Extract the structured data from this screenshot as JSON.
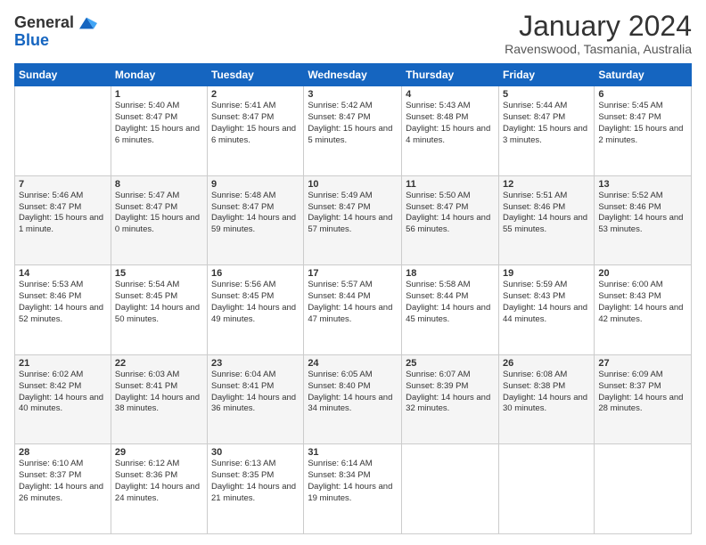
{
  "logo": {
    "general": "General",
    "blue": "Blue"
  },
  "header": {
    "title": "January 2024",
    "location": "Ravenswood, Tasmania, Australia"
  },
  "weekdays": [
    "Sunday",
    "Monday",
    "Tuesday",
    "Wednesday",
    "Thursday",
    "Friday",
    "Saturday"
  ],
  "weeks": [
    [
      {
        "day": "",
        "sunrise": "",
        "sunset": "",
        "daylight": ""
      },
      {
        "day": "1",
        "sunrise": "Sunrise: 5:40 AM",
        "sunset": "Sunset: 8:47 PM",
        "daylight": "Daylight: 15 hours and 6 minutes."
      },
      {
        "day": "2",
        "sunrise": "Sunrise: 5:41 AM",
        "sunset": "Sunset: 8:47 PM",
        "daylight": "Daylight: 15 hours and 6 minutes."
      },
      {
        "day": "3",
        "sunrise": "Sunrise: 5:42 AM",
        "sunset": "Sunset: 8:47 PM",
        "daylight": "Daylight: 15 hours and 5 minutes."
      },
      {
        "day": "4",
        "sunrise": "Sunrise: 5:43 AM",
        "sunset": "Sunset: 8:48 PM",
        "daylight": "Daylight: 15 hours and 4 minutes."
      },
      {
        "day": "5",
        "sunrise": "Sunrise: 5:44 AM",
        "sunset": "Sunset: 8:47 PM",
        "daylight": "Daylight: 15 hours and 3 minutes."
      },
      {
        "day": "6",
        "sunrise": "Sunrise: 5:45 AM",
        "sunset": "Sunset: 8:47 PM",
        "daylight": "Daylight: 15 hours and 2 minutes."
      }
    ],
    [
      {
        "day": "7",
        "sunrise": "Sunrise: 5:46 AM",
        "sunset": "Sunset: 8:47 PM",
        "daylight": "Daylight: 15 hours and 1 minute."
      },
      {
        "day": "8",
        "sunrise": "Sunrise: 5:47 AM",
        "sunset": "Sunset: 8:47 PM",
        "daylight": "Daylight: 15 hours and 0 minutes."
      },
      {
        "day": "9",
        "sunrise": "Sunrise: 5:48 AM",
        "sunset": "Sunset: 8:47 PM",
        "daylight": "Daylight: 14 hours and 59 minutes."
      },
      {
        "day": "10",
        "sunrise": "Sunrise: 5:49 AM",
        "sunset": "Sunset: 8:47 PM",
        "daylight": "Daylight: 14 hours and 57 minutes."
      },
      {
        "day": "11",
        "sunrise": "Sunrise: 5:50 AM",
        "sunset": "Sunset: 8:47 PM",
        "daylight": "Daylight: 14 hours and 56 minutes."
      },
      {
        "day": "12",
        "sunrise": "Sunrise: 5:51 AM",
        "sunset": "Sunset: 8:46 PM",
        "daylight": "Daylight: 14 hours and 55 minutes."
      },
      {
        "day": "13",
        "sunrise": "Sunrise: 5:52 AM",
        "sunset": "Sunset: 8:46 PM",
        "daylight": "Daylight: 14 hours and 53 minutes."
      }
    ],
    [
      {
        "day": "14",
        "sunrise": "Sunrise: 5:53 AM",
        "sunset": "Sunset: 8:46 PM",
        "daylight": "Daylight: 14 hours and 52 minutes."
      },
      {
        "day": "15",
        "sunrise": "Sunrise: 5:54 AM",
        "sunset": "Sunset: 8:45 PM",
        "daylight": "Daylight: 14 hours and 50 minutes."
      },
      {
        "day": "16",
        "sunrise": "Sunrise: 5:56 AM",
        "sunset": "Sunset: 8:45 PM",
        "daylight": "Daylight: 14 hours and 49 minutes."
      },
      {
        "day": "17",
        "sunrise": "Sunrise: 5:57 AM",
        "sunset": "Sunset: 8:44 PM",
        "daylight": "Daylight: 14 hours and 47 minutes."
      },
      {
        "day": "18",
        "sunrise": "Sunrise: 5:58 AM",
        "sunset": "Sunset: 8:44 PM",
        "daylight": "Daylight: 14 hours and 45 minutes."
      },
      {
        "day": "19",
        "sunrise": "Sunrise: 5:59 AM",
        "sunset": "Sunset: 8:43 PM",
        "daylight": "Daylight: 14 hours and 44 minutes."
      },
      {
        "day": "20",
        "sunrise": "Sunrise: 6:00 AM",
        "sunset": "Sunset: 8:43 PM",
        "daylight": "Daylight: 14 hours and 42 minutes."
      }
    ],
    [
      {
        "day": "21",
        "sunrise": "Sunrise: 6:02 AM",
        "sunset": "Sunset: 8:42 PM",
        "daylight": "Daylight: 14 hours and 40 minutes."
      },
      {
        "day": "22",
        "sunrise": "Sunrise: 6:03 AM",
        "sunset": "Sunset: 8:41 PM",
        "daylight": "Daylight: 14 hours and 38 minutes."
      },
      {
        "day": "23",
        "sunrise": "Sunrise: 6:04 AM",
        "sunset": "Sunset: 8:41 PM",
        "daylight": "Daylight: 14 hours and 36 minutes."
      },
      {
        "day": "24",
        "sunrise": "Sunrise: 6:05 AM",
        "sunset": "Sunset: 8:40 PM",
        "daylight": "Daylight: 14 hours and 34 minutes."
      },
      {
        "day": "25",
        "sunrise": "Sunrise: 6:07 AM",
        "sunset": "Sunset: 8:39 PM",
        "daylight": "Daylight: 14 hours and 32 minutes."
      },
      {
        "day": "26",
        "sunrise": "Sunrise: 6:08 AM",
        "sunset": "Sunset: 8:38 PM",
        "daylight": "Daylight: 14 hours and 30 minutes."
      },
      {
        "day": "27",
        "sunrise": "Sunrise: 6:09 AM",
        "sunset": "Sunset: 8:37 PM",
        "daylight": "Daylight: 14 hours and 28 minutes."
      }
    ],
    [
      {
        "day": "28",
        "sunrise": "Sunrise: 6:10 AM",
        "sunset": "Sunset: 8:37 PM",
        "daylight": "Daylight: 14 hours and 26 minutes."
      },
      {
        "day": "29",
        "sunrise": "Sunrise: 6:12 AM",
        "sunset": "Sunset: 8:36 PM",
        "daylight": "Daylight: 14 hours and 24 minutes."
      },
      {
        "day": "30",
        "sunrise": "Sunrise: 6:13 AM",
        "sunset": "Sunset: 8:35 PM",
        "daylight": "Daylight: 14 hours and 21 minutes."
      },
      {
        "day": "31",
        "sunrise": "Sunrise: 6:14 AM",
        "sunset": "Sunset: 8:34 PM",
        "daylight": "Daylight: 14 hours and 19 minutes."
      },
      {
        "day": "",
        "sunrise": "",
        "sunset": "",
        "daylight": ""
      },
      {
        "day": "",
        "sunrise": "",
        "sunset": "",
        "daylight": ""
      },
      {
        "day": "",
        "sunrise": "",
        "sunset": "",
        "daylight": ""
      }
    ]
  ]
}
